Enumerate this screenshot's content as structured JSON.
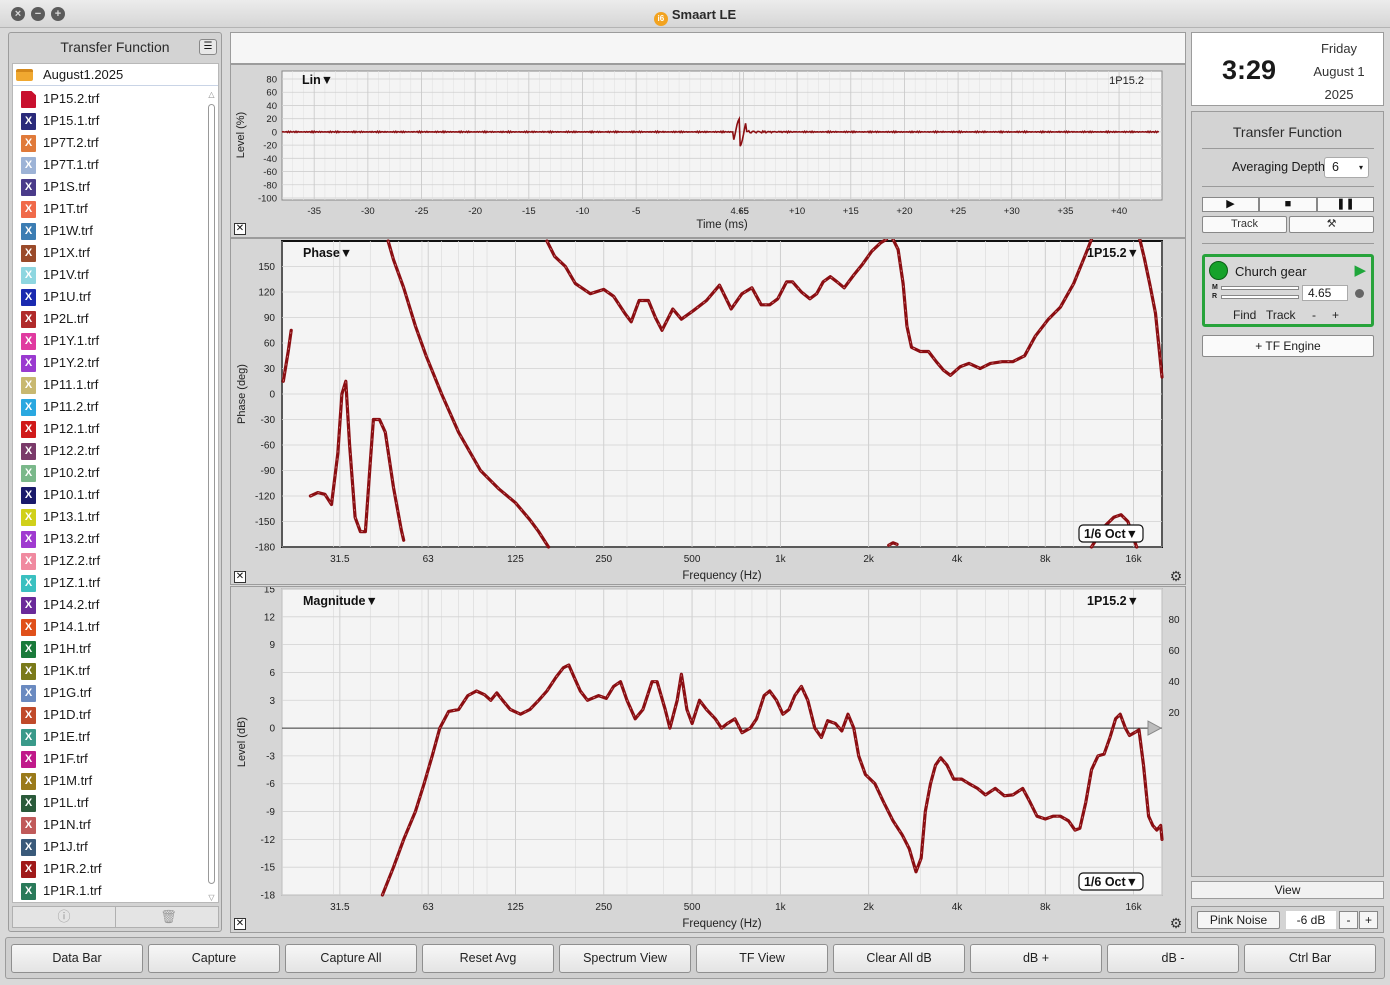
{
  "window": {
    "title": "Smaart LE",
    "logo_text": "i6"
  },
  "left_panel": {
    "title": "Transfer Function",
    "folder": "August1.2025",
    "files": [
      {
        "name": "1P15.2.trf",
        "color": "#c8102e",
        "active": true
      },
      {
        "name": "1P15.1.trf",
        "color": "#2a2a7a"
      },
      {
        "name": "1P7T.2.trf",
        "color": "#e07a3a"
      },
      {
        "name": "1P7T.1.trf",
        "color": "#9db3d6"
      },
      {
        "name": "1P1S.trf",
        "color": "#4a3b8a"
      },
      {
        "name": "1P1T.trf",
        "color": "#f06a4a"
      },
      {
        "name": "1P1W.trf",
        "color": "#3c7db3"
      },
      {
        "name": "1P1X.trf",
        "color": "#9a4a2a"
      },
      {
        "name": "1P1V.trf",
        "color": "#8ed6e0"
      },
      {
        "name": "1P1U.trf",
        "color": "#1a2ab0"
      },
      {
        "name": "1P2L.trf",
        "color": "#b02a2a"
      },
      {
        "name": "1P1Y.1.trf",
        "color": "#e03aa0"
      },
      {
        "name": "1P1Y.2.trf",
        "color": "#9a3ad0"
      },
      {
        "name": "1P11.1.trf",
        "color": "#c8b870"
      },
      {
        "name": "1P11.2.trf",
        "color": "#2aa8e0"
      },
      {
        "name": "1P12.1.trf",
        "color": "#d01a1a"
      },
      {
        "name": "1P12.2.trf",
        "color": "#7a3a6a"
      },
      {
        "name": "1P10.2.trf",
        "color": "#7ab88a"
      },
      {
        "name": "1P10.1.trf",
        "color": "#1a1a6a"
      },
      {
        "name": "1P13.1.trf",
        "color": "#d0d01a"
      },
      {
        "name": "1P13.2.trf",
        "color": "#a03ad0"
      },
      {
        "name": "1P1Z.2.trf",
        "color": "#f08aa0"
      },
      {
        "name": "1P1Z.1.trf",
        "color": "#3ac0c0"
      },
      {
        "name": "1P14.2.trf",
        "color": "#6a2a9a"
      },
      {
        "name": "1P14.1.trf",
        "color": "#e0501a"
      },
      {
        "name": "1P1H.trf",
        "color": "#1a7a3a"
      },
      {
        "name": "1P1K.trf",
        "color": "#7a7a1a"
      },
      {
        "name": "1P1G.trf",
        "color": "#6a8ac0"
      },
      {
        "name": "1P1D.trf",
        "color": "#c04a2a"
      },
      {
        "name": "1P1E.trf",
        "color": "#3a9a8a"
      },
      {
        "name": "1P1F.trf",
        "color": "#c01a8a"
      },
      {
        "name": "1P1M.trf",
        "color": "#9a7a1a"
      },
      {
        "name": "1P1L.trf",
        "color": "#2a5a3a"
      },
      {
        "name": "1P1N.trf",
        "color": "#c05a5a"
      },
      {
        "name": "1P1J.trf",
        "color": "#3a5a7a"
      },
      {
        "name": "1P1R.2.trf",
        "color": "#a01a1a"
      },
      {
        "name": "1P1R.1.trf",
        "color": "#2a7a5a"
      }
    ],
    "footer": {
      "info_icon": "info-icon",
      "trash_icon": "trash-icon"
    }
  },
  "plots": {
    "impulse": {
      "mode_label": "Lin",
      "trace_label": "1P15.2",
      "ylabel": "Level (%)",
      "xlabel": "Time (ms)",
      "y_ticks": [
        "80",
        "60",
        "40",
        "20",
        "0",
        "-20",
        "-40",
        "-60",
        "-80",
        "-100"
      ],
      "x_ticks": [
        "-35",
        "-30",
        "-25",
        "-20",
        "-15",
        "-10",
        "-5",
        "4.65",
        "+5",
        "+10",
        "+15",
        "+20",
        "+25",
        "+30",
        "+35",
        "+40"
      ]
    },
    "phase": {
      "mode_label": "Phase",
      "trace_label": "1P15.2",
      "ylabel": "Phase (deg)",
      "xlabel": "Frequency (Hz)",
      "smoothing": "1/6 Oct",
      "y_ticks": [
        "150",
        "120",
        "90",
        "60",
        "30",
        "0",
        "-30",
        "-60",
        "-90",
        "-120",
        "-150",
        "-180"
      ],
      "x_ticks": [
        "31.5",
        "63",
        "125",
        "250",
        "500",
        "1k",
        "2k",
        "4k",
        "8k",
        "16k"
      ]
    },
    "magnitude": {
      "mode_label": "Magnitude",
      "trace_label": "1P15.2",
      "ylabel": "Level (dB)",
      "xlabel": "Frequency (Hz)",
      "smoothing": "1/6 Oct",
      "y_ticks": [
        "15",
        "12",
        "9",
        "6",
        "3",
        "0",
        "-3",
        "-6",
        "-9",
        "-12",
        "-15",
        "-18"
      ],
      "y2_ticks": [
        "80",
        "60",
        "40",
        "20"
      ],
      "x_ticks": [
        "31.5",
        "63",
        "125",
        "250",
        "500",
        "1k",
        "2k",
        "4k",
        "8k",
        "16k"
      ]
    },
    "trace_color": "#8b0e12"
  },
  "clock": {
    "time": "3:29",
    "weekday": "Friday",
    "date": "August 1",
    "year": "2025"
  },
  "tf_panel": {
    "title": "Transfer Function",
    "averaging_label": "Averaging Depth:",
    "averaging_value": "6",
    "track_label": "Track",
    "engine": {
      "name": "Church gear",
      "delay": "4.65",
      "m_label": "M",
      "r_label": "R",
      "find_label": "Find",
      "track_label": "Track",
      "minus_label": "-",
      "plus_label": "+"
    },
    "add_engine_label": "+ TF Engine"
  },
  "view_label": "View",
  "generator": {
    "label": "Pink Noise",
    "gain": "-6 dB",
    "minus": "-",
    "plus": "+"
  },
  "bottom_buttons": [
    "Data Bar",
    "Capture",
    "Capture All",
    "Reset Avg",
    "Spectrum View",
    "TF View",
    "Clear All dB",
    "dB +",
    "dB -",
    "Ctrl Bar"
  ]
}
